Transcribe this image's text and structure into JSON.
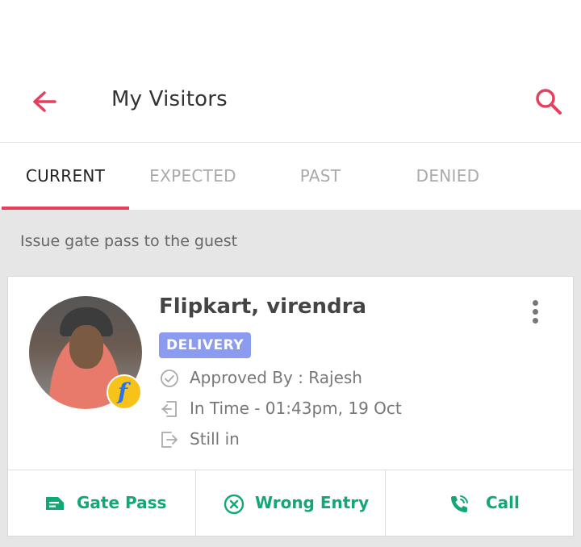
{
  "header": {
    "title": "My Visitors",
    "back_icon": "arrow-left-icon",
    "search_icon": "search-icon",
    "accent_color": "#e63e5c"
  },
  "tabs": [
    {
      "label": "CURRENT",
      "active": true
    },
    {
      "label": "EXPECTED",
      "active": false
    },
    {
      "label": "PAST",
      "active": false
    },
    {
      "label": "DENIED",
      "active": false
    }
  ],
  "hint": "Issue gate pass to the guest",
  "visitor": {
    "name": "Flipkart, virendra",
    "type": "DELIVERY",
    "type_color": "#8b9cf0",
    "brand_badge": "f",
    "approved": "Approved By : Rajesh",
    "in_time": "In Time - 01:43pm, 19 Oct",
    "status": "Still in"
  },
  "actions": {
    "gate_pass": "Gate Pass",
    "wrong_entry": "Wrong Entry",
    "call": "Call",
    "action_color": "#11a873"
  }
}
